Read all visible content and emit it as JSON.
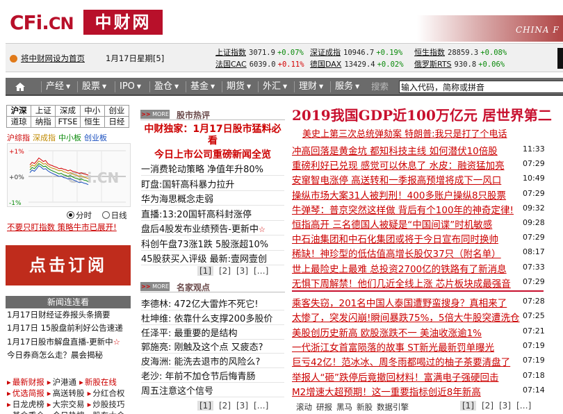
{
  "header": {
    "logo_cfi": "CFi.",
    "logo_cn": "CN",
    "logo_zh": "中财网",
    "tagline": "CHINA F"
  },
  "infobar": {
    "home_link": "将中财网设为首页",
    "date": "1月17日星期[5]",
    "indices": [
      {
        "name": "上证指数",
        "value": "3071.9",
        "change": "+0.07%",
        "dir": "up"
      },
      {
        "name": "深证成指",
        "value": "10946.7",
        "change": "+0.19%",
        "dir": "up"
      },
      {
        "name": "恒生指数",
        "value": "28859.3",
        "change": "+0.08%",
        "dir": "up"
      },
      {
        "name": "法国CAC",
        "value": "6039.0",
        "change": "+0.11%",
        "dir": "dn"
      },
      {
        "name": "德国DAX",
        "value": "13429.4",
        "change": "+0.02%",
        "dir": "up"
      },
      {
        "name": "俄罗斯RTS",
        "value": "930.8",
        "change": "+0.06%",
        "dir": "up"
      }
    ]
  },
  "nav": {
    "items": [
      "产经",
      "股票",
      "IPO",
      "盈仓",
      "基金",
      "期货",
      "外汇",
      "理财",
      "服务"
    ],
    "search_label": "搜索",
    "search_value": "输入代码，简称或拼音"
  },
  "market": {
    "tabs_row1": [
      "沪深",
      "上证",
      "深成",
      "中小",
      "创业"
    ],
    "tabs_row2": [
      "道琼",
      "纳指",
      "FTSE",
      "恒生",
      "日经"
    ],
    "chart_tabs": [
      "沪综指",
      "深成指",
      "中小板",
      "创业板"
    ],
    "y_labels": [
      "+1%",
      "+0%",
      "-1%"
    ],
    "watermark": "CFi.CN",
    "radio_fenshi": "分时",
    "radio_rixian": "日线",
    "promo": "不要只盯指数 策略牛市已展开!",
    "series_hu": [
      0.45,
      0.55,
      0.5,
      0.6,
      0.72,
      0.65,
      0.58,
      0.62,
      0.5,
      0.45,
      0.42,
      0.38,
      0.35,
      0.3,
      0.32,
      0.28,
      0.26,
      0.22,
      0.25,
      0.2,
      0.18,
      0.15,
      0.12,
      0.14,
      0.1,
      0.08,
      0.05
    ],
    "series_shen": [
      0.35,
      0.45,
      0.4,
      0.5,
      0.6,
      0.55,
      0.48,
      0.5,
      0.42,
      0.36,
      0.32,
      0.3,
      0.26,
      0.22,
      0.24,
      0.18,
      0.16,
      0.12,
      0.15,
      0.1,
      0.06,
      0.04,
      0.0,
      0.02,
      -0.02,
      -0.05,
      -0.08
    ],
    "series_zx": [
      0.25,
      0.35,
      0.3,
      0.4,
      0.5,
      0.45,
      0.38,
      0.4,
      0.32,
      0.26,
      0.22,
      0.18,
      0.14,
      0.1,
      0.12,
      0.06,
      0.04,
      0.0,
      0.03,
      -0.02,
      -0.06,
      -0.08,
      -0.12,
      -0.1,
      -0.14,
      -0.16,
      -0.2
    ],
    "series_cy": [
      0.15,
      0.25,
      0.2,
      0.3,
      0.42,
      0.36,
      0.28,
      0.3,
      0.22,
      0.16,
      0.12,
      0.08,
      0.04,
      0.0,
      0.02,
      -0.04,
      -0.06,
      -0.1,
      -0.08,
      -0.12,
      -0.16,
      -0.2,
      -0.24,
      -0.22,
      -0.26,
      -0.28,
      -0.32
    ]
  },
  "subscribe_label": "点击订阅",
  "news_conn": {
    "title": "新闻连连看",
    "items": [
      "1月17日财经证券报头条摘要",
      "1月17日 15股盘前利好公告速递",
      "1月17日股市解盘直播-更新中",
      "今日券商怎么走？晨会揭秘"
    ]
  },
  "left_links": [
    [
      [
        "最新财报",
        "red"
      ],
      [
        "沪港通",
        ""
      ],
      [
        "新股在线",
        "red"
      ]
    ],
    [
      [
        "优选简报",
        "red"
      ],
      [
        "高送转股",
        ""
      ],
      [
        "分红合权",
        ""
      ]
    ],
    [
      [
        "日龙虎榜",
        ""
      ],
      [
        "大宗交易",
        ""
      ],
      [
        "炒股技巧",
        ""
      ]
    ],
    [
      [
        "基金重仓",
        ""
      ],
      [
        "今日热搜",
        ""
      ],
      [
        "股东大会",
        ""
      ]
    ]
  ],
  "stock_hot": {
    "more": "MORE",
    "title": "股市热评",
    "headline1": "中财独家：1月17日股市猛料必看",
    "headline2": "今日上市公司重磅新闻全览",
    "items": [
      "一消费轮动策略 净值年升80%",
      "盯盘:国轩高科暴力拉升",
      "华为海思概念走弱",
      "直播:13:20国轩高科封涨停",
      "盘后4股发布业绩预告-更新中",
      "科创午盘73涨1跌 5股涨超10%",
      "45股获买入评级 最新:壹网壹创"
    ],
    "pager": [
      "[1]",
      "[2]",
      "[3]",
      "[…]"
    ]
  },
  "expert": {
    "more": "MORE",
    "title": "名家观点",
    "items": [
      "李德林: 472亿大雷炸不死它!",
      "杜坤维: 依靠什么支撑200多股价",
      "任泽平: 最重要的是结构",
      "郭施亮: 刚触及这个点 又疲态?",
      "皮海洲: 能洗去退市的风险么?",
      "老沙: 年前不加仓节后悔青肠",
      "周五注意这个信号"
    ],
    "pager": [
      "[1]",
      "[2]",
      "[3]",
      "[…]"
    ]
  },
  "top_news": {
    "headline": "2019我国GDP近100万亿元 居世界第二",
    "subheadline": "美史上第三次总统弹劾案 特朗普:我只是打了个电话",
    "group1": [
      {
        "title": "冲高回落是黄金坑 都知科技主线 如何潜伏10倍股",
        "time": "11:33"
      },
      {
        "title": "重磅利好已兑现 感觉可以休息了 水皮：融资猛加亮",
        "time": "07:29"
      },
      {
        "title": "安窜智电涨停 高送转和一季报高预增将成下一风口",
        "time": "10:49"
      },
      {
        "title": "操纵市场大案31人被判刑！400多账户操纵8只股票",
        "time": "07:29"
      },
      {
        "title": "牛弹琴：普京突然这样做 背后有个100年的神奇定律!",
        "time": "09:32"
      },
      {
        "title": "恒指高开 三名德国人被疑是“中国间谍”时机敏感",
        "time": "09:28"
      },
      {
        "title": "中石油集团和中石化集团或将于今日宣布同时换帅",
        "time": "07:29"
      },
      {
        "title": "稀缺！神珍型的低估值高增长股仅37只（附名单）",
        "time": "08:17"
      },
      {
        "title": "世上最险史上最难 总投资2700亿的铁路有了新消息",
        "time": "07:33"
      },
      {
        "title": "无惧下周解禁！他们几近全线上涨 芯片板块成最强音",
        "time": "07:29"
      }
    ],
    "group2": [
      {
        "title": "乘客失窃，201名中国人泰国遭野蛮搜身？真相来了",
        "time": "07:28"
      },
      {
        "title": "太惨了，突发闪崩!瞬间暴跌75%，5倍大牛股突遭洗仓",
        "time": "07:25"
      },
      {
        "title": "美股创历史新高 欧股涨跌不一 美油收涨逾1%",
        "time": "07:21"
      },
      {
        "title": "一代浙江女首富陨落的故事 ST新光最新罚单曝光",
        "time": "07:19"
      },
      {
        "title": "巨亏42亿！范冰冰、周冬雨都喝过的柚子茶要清盘了",
        "time": "07:19"
      },
      {
        "title": "举报人“砸”跌停后竟撤回材料！富满电子强硬回击",
        "time": "07:18"
      },
      {
        "title": "M2增速大超预期！这一重要指标创近8年新高",
        "time": "07:14"
      }
    ],
    "bottom_links": [
      "滚动",
      "研报",
      "黑马",
      "新股",
      "数据引擎"
    ],
    "pager": [
      "[1]",
      "[2]",
      "[3]",
      "[…]"
    ]
  },
  "colors": {
    "brand_red": "#b8102a",
    "nav_gray": "#6b6b6b",
    "up_green": "#0a8a0a",
    "down_red": "#d40000"
  }
}
